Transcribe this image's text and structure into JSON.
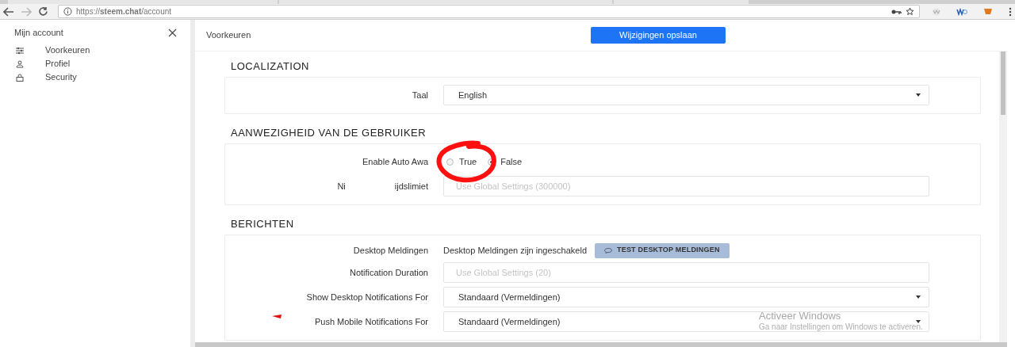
{
  "browser": {
    "url": "https://**steem.chat**/account"
  },
  "sidebar": {
    "title": "Mijn account",
    "items": [
      {
        "kind": "sliders",
        "label": "Voorkeuren"
      },
      {
        "kind": "person",
        "label": "Profiel"
      },
      {
        "kind": "lock",
        "label": "Security"
      }
    ]
  },
  "header": {
    "title": "Voorkeuren",
    "save_button": "Wijzigingen opslaan"
  },
  "sections": [
    {
      "title": "LOCALIZATION",
      "rows": [
        {
          "kind": "select",
          "label": "Taal",
          "value": "English"
        }
      ]
    },
    {
      "title": "AANWEZIGHEID VAN DE GEBRUIKER",
      "rows": [
        {
          "kind": "radio",
          "label": "Enable Auto Awa",
          "options": [
            {
              "label": "True",
              "selected": false
            },
            {
              "label": "False",
              "selected": true
            }
          ]
        },
        {
          "kind": "input",
          "label_parts": [
            "Ni",
            "ijdslimiet"
          ],
          "placeholder": "Use Global Settings (300000)"
        }
      ]
    },
    {
      "title": "BERICHTEN",
      "rows": [
        {
          "kind": "status",
          "label": "Desktop Meldingen",
          "status": "Desktop Meldingen zijn ingeschakeld",
          "button": "TEST DESKTOP MELDINGEN"
        },
        {
          "kind": "input",
          "label_parts": [
            "Notification Duration"
          ],
          "placeholder": "Use Global Settings (20)"
        },
        {
          "kind": "select",
          "label": "Show Desktop Notifications For",
          "value": "Standaard (Vermeldingen)"
        },
        {
          "kind": "select",
          "label": "Push Mobile Notifications For",
          "value": "Standaard (Vermeldingen)"
        }
      ]
    }
  ],
  "watermark": {
    "title": "Activeer Windows",
    "subtitle": "Ga naar Instellingen om Windows te activeren."
  }
}
